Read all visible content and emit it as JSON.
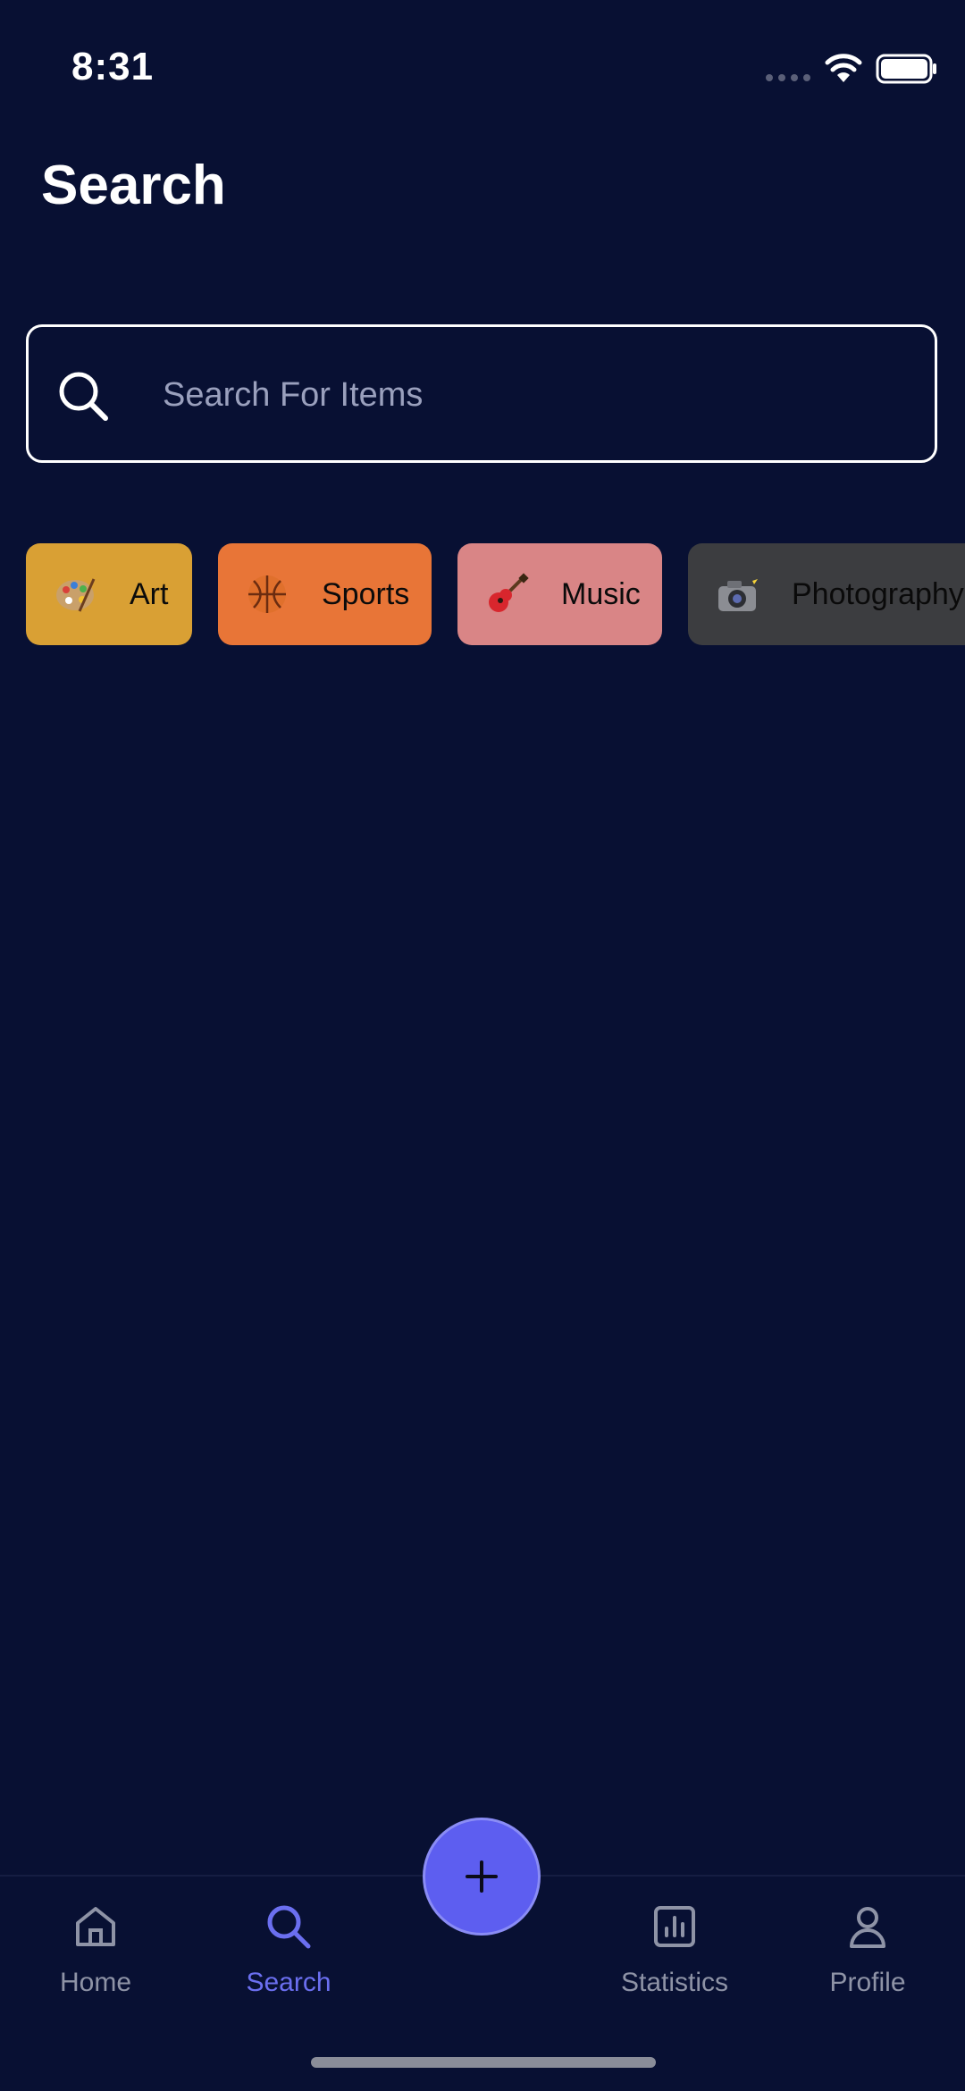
{
  "status_bar": {
    "time": "8:31"
  },
  "page": {
    "title": "Search"
  },
  "search": {
    "placeholder": "Search For Items",
    "value": ""
  },
  "categories": [
    {
      "label": "Art",
      "icon": "artist-palette-icon",
      "color": "#d9a034"
    },
    {
      "label": "Sports",
      "icon": "basketball-icon",
      "color": "#e87537"
    },
    {
      "label": "Music",
      "icon": "guitar-icon",
      "color": "#d98586"
    },
    {
      "label": "Photography",
      "icon": "camera-with-flash-icon",
      "color": "#3c3d40"
    }
  ],
  "bottom_nav": {
    "items": [
      {
        "label": "Home",
        "icon": "home-icon",
        "active": false
      },
      {
        "label": "Search",
        "icon": "search-icon",
        "active": true
      },
      {
        "label": "Statistics",
        "icon": "statistics-icon",
        "active": false
      },
      {
        "label": "Profile",
        "icon": "profile-icon",
        "active": false
      }
    ],
    "fab_icon": "plus-icon"
  },
  "colors": {
    "background": "#081033",
    "accent": "#5d5ef0",
    "active_nav": "#6b6ff0",
    "inactive_nav": "#8e93a6"
  }
}
